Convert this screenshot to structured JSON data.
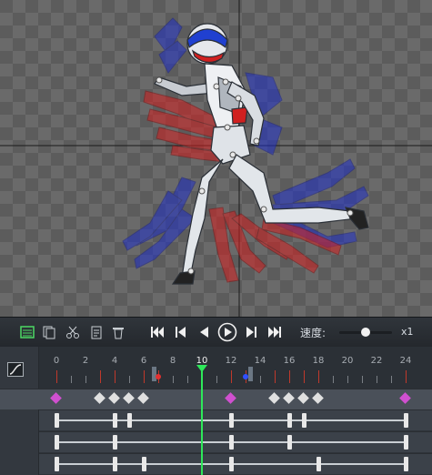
{
  "viewport": {
    "background": "checkerboard",
    "crosshair_color": "#1a1a1a",
    "figure": "robot-mannequin-running-with-onion-skin",
    "onion_prev_color": "#d42020",
    "onion_next_color": "#2030c8"
  },
  "toolbar": {
    "tools": [
      {
        "id": "timeline-view",
        "icon": "timeline-icon"
      },
      {
        "id": "copy",
        "icon": "copy-icon"
      },
      {
        "id": "cut",
        "icon": "scissors-icon"
      },
      {
        "id": "paste",
        "icon": "paste-icon"
      },
      {
        "id": "delete",
        "icon": "trash-icon"
      }
    ],
    "playback": [
      {
        "id": "first-frame",
        "icon": "skip-to-start-icon"
      },
      {
        "id": "prev-keyframe",
        "icon": "prev-keyframe-icon"
      },
      {
        "id": "prev-frame",
        "icon": "step-back-icon"
      },
      {
        "id": "play",
        "icon": "play-icon"
      },
      {
        "id": "next-keyframe",
        "icon": "next-keyframe-icon"
      },
      {
        "id": "last-frame",
        "icon": "skip-to-end-icon"
      }
    ],
    "speed_label": "速度:",
    "speed_level": 0.5,
    "speed_value": "x1"
  },
  "timeline": {
    "current_frame": 10,
    "current_frame_label": "10",
    "ruler_labels": [
      "0",
      "2",
      "4",
      "6",
      "8",
      "10",
      "12",
      "14",
      "16",
      "18",
      "20",
      "22",
      "24"
    ],
    "frame_start": 0,
    "frame_end": 24,
    "range_start": 7,
    "range_end": 13,
    "range_start_color": "#e53030",
    "range_end_color": "#3050ff",
    "major_ticks": [
      0,
      3,
      4,
      6,
      7,
      12,
      13,
      15,
      16,
      17,
      18,
      24
    ],
    "marker_keys": [
      {
        "frame": 0,
        "color": "#d050d0"
      },
      {
        "frame": 3,
        "color": "#e0e0e0"
      },
      {
        "frame": 4,
        "color": "#e0e0e0"
      },
      {
        "frame": 5,
        "color": "#e0e0e0"
      },
      {
        "frame": 6,
        "color": "#e0e0e0"
      },
      {
        "frame": 12,
        "color": "#d050d0"
      },
      {
        "frame": 15,
        "color": "#e0e0e0"
      },
      {
        "frame": 16,
        "color": "#e0e0e0"
      },
      {
        "frame": 17,
        "color": "#e0e0e0"
      },
      {
        "frame": 18,
        "color": "#e0e0e0"
      },
      {
        "frame": 24,
        "color": "#d050d0"
      }
    ],
    "tracks": [
      {
        "keys": [
          0,
          4,
          5,
          12,
          16,
          17,
          24
        ]
      },
      {
        "keys": [
          0,
          4,
          12,
          16,
          24
        ]
      },
      {
        "keys": [
          0,
          4,
          6,
          12,
          18,
          24
        ]
      }
    ]
  }
}
